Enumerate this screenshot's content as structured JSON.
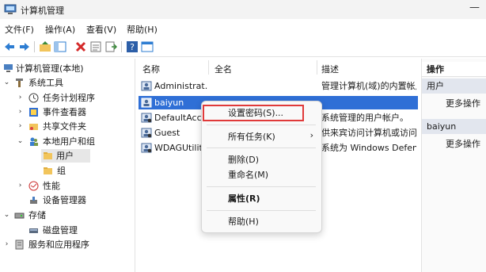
{
  "window": {
    "title": "计算机管理",
    "minimize_glyph": "—"
  },
  "menu": [
    "文件(F)",
    "操作(A)",
    "查看(V)",
    "帮助(H)"
  ],
  "tree": {
    "root": "计算机管理(本地)",
    "system_tools": "系统工具",
    "task_scheduler": "任务计划程序",
    "event_viewer": "事件查看器",
    "shared_folders": "共享文件夹",
    "local_users": "本地用户和组",
    "users": "用户",
    "groups": "组",
    "performance": "性能",
    "device_manager": "设备管理器",
    "storage": "存储",
    "disk_management": "磁盘管理",
    "services": "服务和应用程序"
  },
  "list": {
    "headers": {
      "name": "名称",
      "fullname": "全名",
      "desc": "描述"
    },
    "rows": [
      {
        "name": "Administrat...",
        "desc": "管理计算机(域)的内置帐户"
      },
      {
        "name": "baiyun",
        "desc": ""
      },
      {
        "name": "DefaultAcc...",
        "desc": "系统管理的用户帐户。"
      },
      {
        "name": "Guest",
        "desc": "供来宾访问计算机或访问域"
      },
      {
        "name": "WDAGUtilit...",
        "desc": "系统为 Windows Defender"
      }
    ]
  },
  "actions": {
    "title": "操作",
    "section1": "用户",
    "more1": "更多操作",
    "section2": "baiyun",
    "more2": "更多操作"
  },
  "context_menu": {
    "set_password": "设置密码(S)...",
    "all_tasks": "所有任务(K)",
    "submenu_arrow": "›",
    "delete": "删除(D)",
    "rename": "重命名(M)",
    "properties": "属性(R)",
    "help": "帮助(H)"
  },
  "colors": {
    "selection": "#2f6fd6",
    "highlight_box": "#e03a3a"
  }
}
